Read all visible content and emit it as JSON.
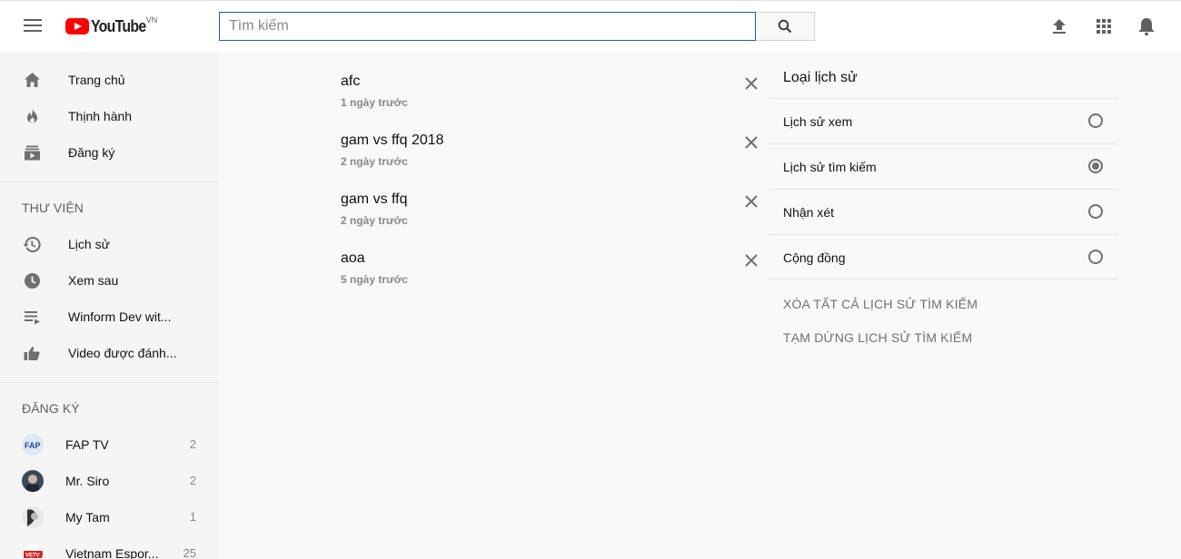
{
  "header": {
    "logo_text": "YouTube",
    "logo_country": "VN",
    "search_placeholder": "Tìm kiếm",
    "search_value": ""
  },
  "sidebar": {
    "main_items": [
      {
        "label": "Trang chủ",
        "icon": "home-icon"
      },
      {
        "label": "Thịnh hành",
        "icon": "trending-flame-icon"
      },
      {
        "label": "Đăng ký",
        "icon": "subscriptions-icon"
      }
    ],
    "library_heading": "THƯ VIỆN",
    "library_items": [
      {
        "label": "Lịch sử",
        "icon": "history-icon"
      },
      {
        "label": "Xem sau",
        "icon": "watch-later-clock-icon"
      },
      {
        "label": "Winform Dev wit...",
        "icon": "playlist-icon"
      },
      {
        "label": "Video được đánh...",
        "icon": "thumbs-up-icon"
      }
    ],
    "subscriptions_heading": "ĐĂNG KÝ",
    "subscriptions": [
      {
        "label": "FAP TV",
        "count": "2"
      },
      {
        "label": "Mr. Siro",
        "count": "2"
      },
      {
        "label": "My Tam",
        "count": "1"
      },
      {
        "label": "Vietnam Espor...",
        "count": "25"
      }
    ]
  },
  "history": [
    {
      "query": "afc",
      "time": "1 ngày trước"
    },
    {
      "query": "gam vs ffq 2018",
      "time": "2 ngày trước"
    },
    {
      "query": "gam vs ffq",
      "time": "2 ngày trước"
    },
    {
      "query": "aoa",
      "time": "5 ngày trước"
    }
  ],
  "panel": {
    "title": "Loại lịch sử",
    "options": [
      {
        "label": "Lịch sử xem",
        "selected": false
      },
      {
        "label": "Lịch sử tìm kiếm",
        "selected": true
      },
      {
        "label": "Nhận xét",
        "selected": false
      },
      {
        "label": "Cộng đồng",
        "selected": false
      }
    ],
    "clear_all": "XÓA TẤT CẢ LỊCH SỬ TÌM KIẾM",
    "pause": "TẠM DỪNG LỊCH SỬ TÌM KIẾM"
  },
  "colors": {
    "brand_red": "#ff0000",
    "search_focus_border": "#1c62b9",
    "sidebar_bg": "#f5f5f5",
    "main_bg": "#f9f9f9"
  }
}
